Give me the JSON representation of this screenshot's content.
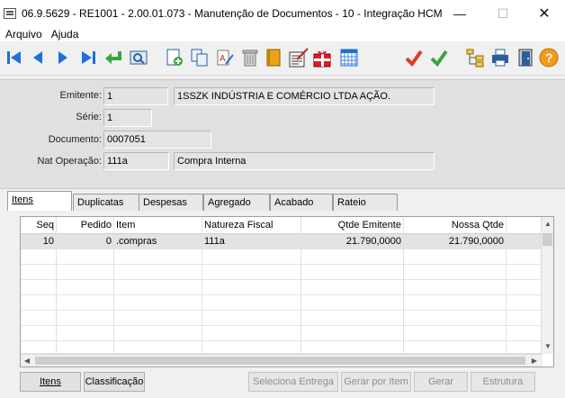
{
  "window": {
    "title": "06.9.5629 - RE1001 - 2.00.01.073 - Manutenção de Documentos - 10 - Integração HCM ..."
  },
  "menu": {
    "items": [
      "Arquivo",
      "Ajuda"
    ]
  },
  "toolbar": {
    "icons": [
      "first-icon",
      "prev-icon",
      "next-icon",
      "last-icon",
      "return-icon",
      "zoom-icon",
      "new-icon",
      "copy-icon",
      "edit-icon",
      "delete-icon",
      "book-icon",
      "notes-icon",
      "gift-icon",
      "calendar-icon",
      "cancel-icon",
      "confirm-icon",
      "tree-icon",
      "print-icon",
      "exit-icon",
      "help-icon"
    ]
  },
  "form": {
    "emitente_label": "Emitente:",
    "emitente_code": "1",
    "emitente_name": "1SSZK INDÚSTRIA E COMÉRCIO LTDA AÇÃO.",
    "serie_label": "Série:",
    "serie_value": "1",
    "documento_label": "Documento:",
    "documento_value": "0007051",
    "natop_label": "Nat Operação:",
    "natop_code": "111a",
    "natop_desc": "Compra Interna"
  },
  "tabs": [
    "Itens",
    "Duplicatas",
    "Despesas",
    "Agregado",
    "Acabado",
    "Rateio"
  ],
  "grid": {
    "columns": [
      "Seq",
      "Pedido",
      "Item",
      "Natureza Fiscal",
      "Qtde Emitente",
      "Nossa Qtde"
    ],
    "rows": [
      {
        "seq": "10",
        "pedido": "0",
        "item": ".compras",
        "natureza": "111a",
        "qtde_emitente": "21.790,0000",
        "nossa_qtde": "21.790,0000"
      }
    ]
  },
  "buttons": {
    "itens": "Itens",
    "classificacao": "Classificação",
    "seleciona_entrega": "Seleciona Entrega",
    "gerar_por_item": "Gerar por Item",
    "gerar": "Gerar",
    "estrutura": "Estrutura"
  },
  "colors": {
    "confirm_green": "#3aa53a",
    "cancel_red": "#e23b2e",
    "nav_blue": "#1e6fd9",
    "help_orange": "#f29a1a"
  }
}
